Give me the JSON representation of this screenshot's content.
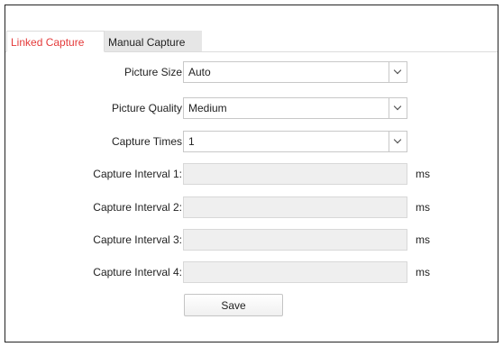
{
  "tabs": {
    "linked_capture": "Linked Capture",
    "manual_capture": "Manual Capture",
    "active_color": "#e43b3b"
  },
  "form": {
    "picture_size": {
      "label": "Picture Size",
      "value": "Auto"
    },
    "picture_quality": {
      "label": "Picture Quality",
      "value": "Medium"
    },
    "capture_times": {
      "label": "Capture Times",
      "value": "1"
    },
    "interval_1": {
      "label": "Capture Interval 1:",
      "value": "",
      "unit": "ms"
    },
    "interval_2": {
      "label": "Capture Interval 2:",
      "value": "",
      "unit": "ms"
    },
    "interval_3": {
      "label": "Capture Interval 3:",
      "value": "",
      "unit": "ms"
    },
    "interval_4": {
      "label": "Capture Interval 4:",
      "value": "",
      "unit": "ms"
    }
  },
  "actions": {
    "save_label": "Save"
  },
  "icons": {
    "dropdown": "chevron-down-icon"
  }
}
